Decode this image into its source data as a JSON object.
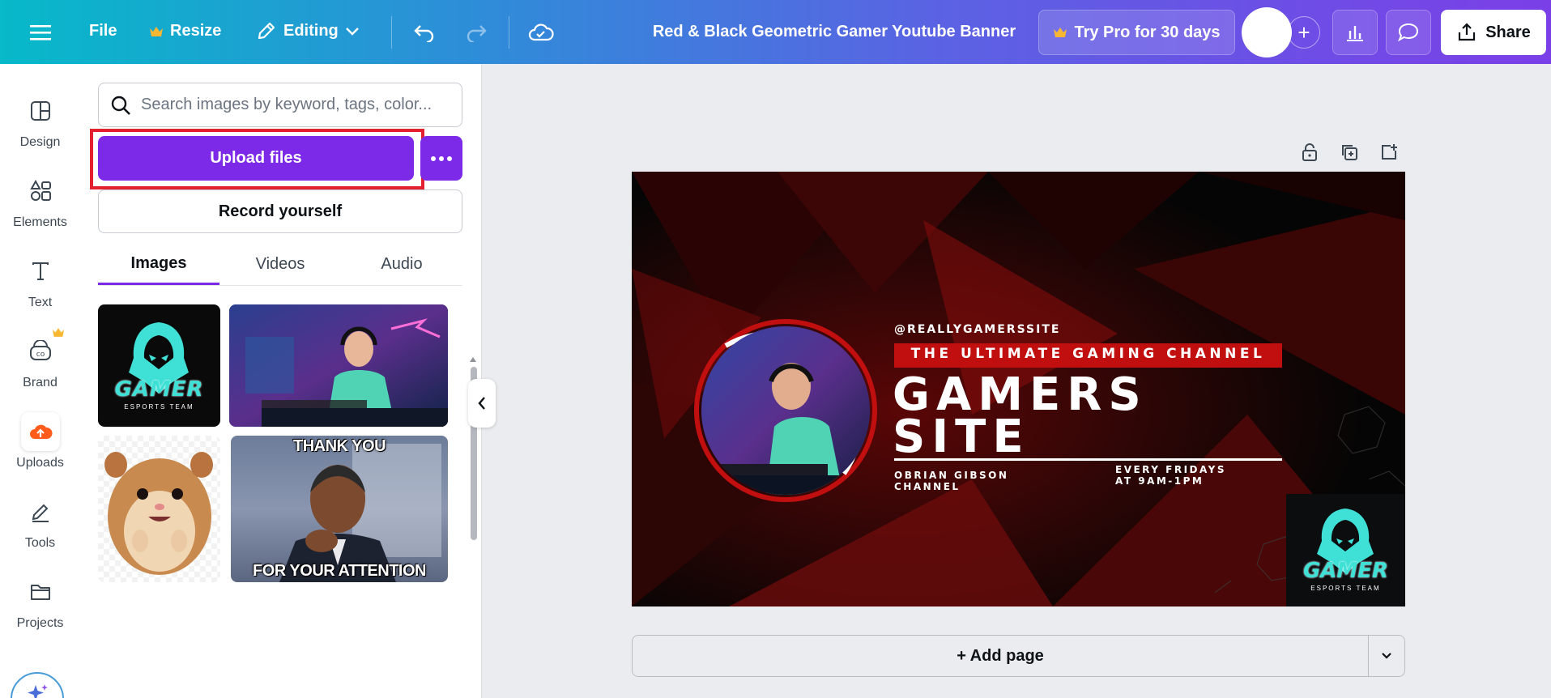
{
  "topbar": {
    "menu_icon": "hamburger-menu-icon",
    "file_label": "File",
    "resize_label": "Resize",
    "editing_label": "Editing",
    "document_title": "Red & Black Geometric Gamer Youtube Banner",
    "try_pro_label": "Try Pro for 30 days",
    "share_label": "Share",
    "brand_crown_color": "#f7b733"
  },
  "rail": {
    "items": [
      {
        "label": "Design",
        "icon": "design-layout-icon"
      },
      {
        "label": "Elements",
        "icon": "elements-shapes-icon"
      },
      {
        "label": "Text",
        "icon": "text-t-icon"
      },
      {
        "label": "Brand",
        "icon": "brand-icon"
      },
      {
        "label": "Uploads",
        "icon": "upload-cloud-icon"
      },
      {
        "label": "Tools",
        "icon": "tools-pen-icon"
      },
      {
        "label": "Projects",
        "icon": "folder-icon"
      }
    ]
  },
  "panel": {
    "search_placeholder": "Search images by keyword, tags, color...",
    "upload_label": "Upload files",
    "record_label": "Record yourself",
    "tabs": [
      {
        "label": "Images",
        "active": true
      },
      {
        "label": "Videos",
        "active": false
      },
      {
        "label": "Audio",
        "active": false
      }
    ],
    "thumbnails": {
      "logo_text": "GAMER",
      "logo_subtext": "ESPORTS TEAM",
      "meme_top": "THANK YOU",
      "meme_bottom": "FOR YOUR ATTENTION"
    }
  },
  "canvas": {
    "handle": "@REALLYGAMERSSITE",
    "tagline": "THE ULTIMATE GAMING CHANNEL",
    "title_line1": "GAMERS",
    "title_line2": "SITE",
    "channel_line1": "OBRIAN GIBSON",
    "channel_line2": "CHANNEL",
    "schedule_line1": "EVERY FRIDAYS",
    "schedule_line2": "AT 9AM-1PM",
    "logo_text": "GAMER",
    "logo_subtext": "ESPORTS TEAM",
    "accent_color": "#c10f0f",
    "logo_color": "#3fe0d6"
  },
  "footer": {
    "add_page_label": "+ Add page"
  }
}
